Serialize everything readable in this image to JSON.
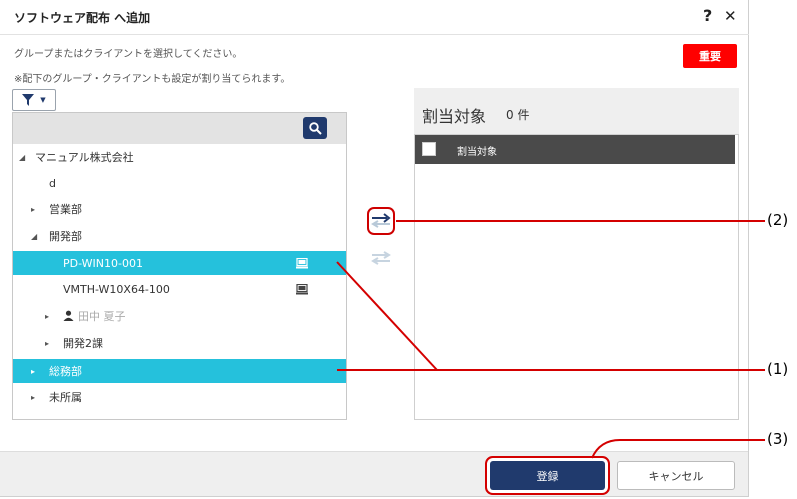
{
  "dialog": {
    "title": "ソフトウェア配布 へ追加",
    "help_glyph": "?",
    "close_glyph": "✕"
  },
  "instructions": {
    "line1": "グループまたはクライアントを選択してください。",
    "line2": "※配下のグループ・クライアントも設定が割り当てられます。"
  },
  "importance_button": "重要",
  "tree": {
    "rows": [
      {
        "label": "マニュアル株式会社",
        "caret": "◢",
        "level": 0
      },
      {
        "label": "d",
        "caret": "",
        "level": 1
      },
      {
        "label": "営業部",
        "caret": "▸",
        "level": 1
      },
      {
        "label": "開発部",
        "caret": "◢",
        "level": 1
      },
      {
        "label": "PD-WIN10-001",
        "caret": "",
        "level": 2,
        "selected": true,
        "pc": true
      },
      {
        "label": "VMTH-W10X64-100",
        "caret": "",
        "level": 2,
        "pc": true
      },
      {
        "label": "田中 夏子",
        "caret": "▸",
        "level": 2,
        "user": true
      },
      {
        "label": "開発2課",
        "caret": "▸",
        "level": 2
      },
      {
        "label": "総務部",
        "caret": "▸",
        "level": 1,
        "selected": true
      },
      {
        "label": "未所属",
        "caret": "▸",
        "level": 1
      }
    ]
  },
  "assigned": {
    "title": "割当対象",
    "count": "0 件",
    "column_header": "割当対象"
  },
  "footer": {
    "register": "登録",
    "cancel": "キャンセル"
  },
  "callouts": {
    "c1": "(1)",
    "c2": "(2)",
    "c3": "(3)"
  },
  "colors": {
    "selection": "#25c1dc",
    "primary": "#203a6d",
    "importance": "#ff0000",
    "callout": "#d40000"
  }
}
